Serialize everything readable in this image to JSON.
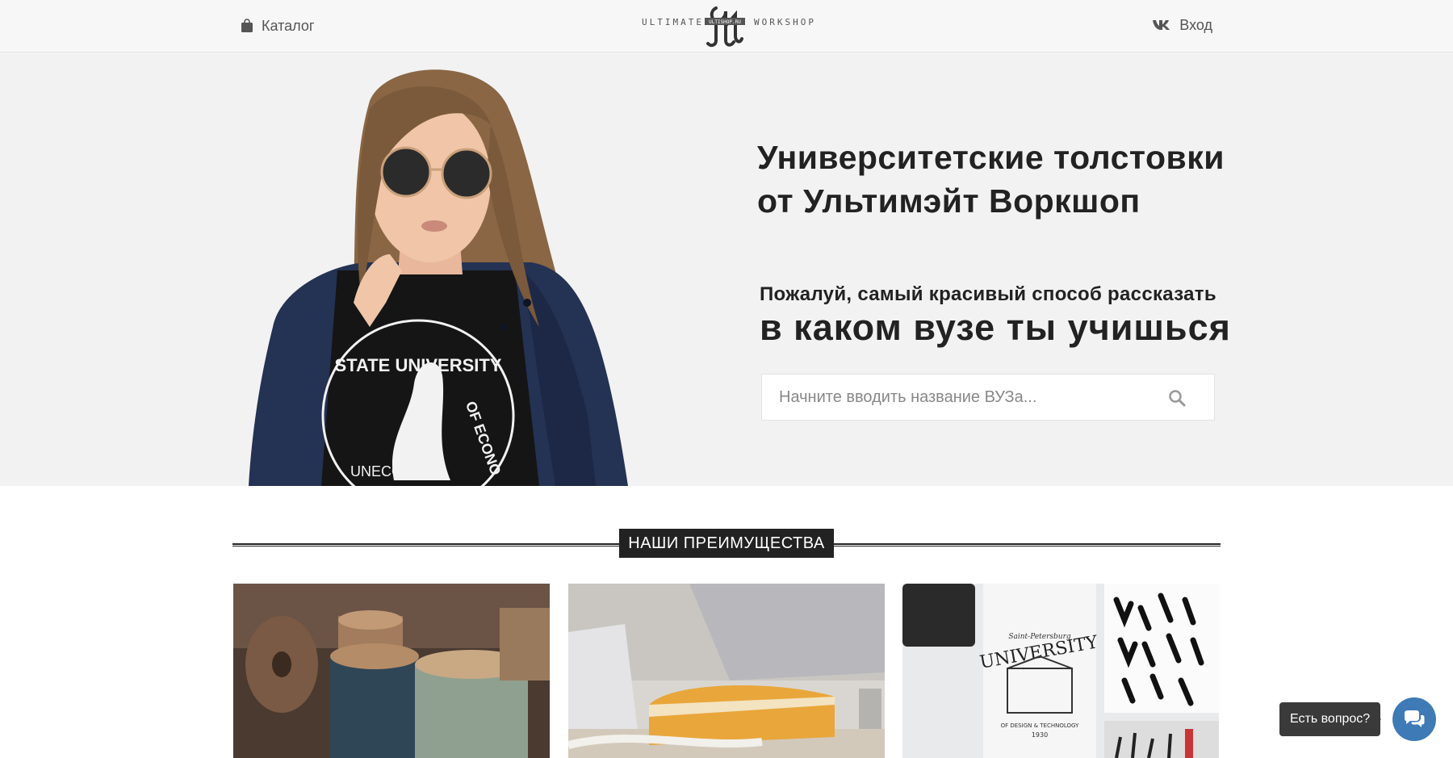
{
  "header": {
    "catalog_label": "Каталог",
    "login_label": "Вход",
    "logo": {
      "left_word": "ULTIMATE",
      "right_word": "WORKSHOP",
      "badge_text": "ULTISHOP.RU"
    }
  },
  "hero": {
    "title_line1": "Университетские толстовки",
    "title_line2": "от Ультимэйт Воркшоп",
    "subtitle_line1": "Пожалуй, самый красивый способ рассказать",
    "subtitle_line2": "в каком вузе ты учишься",
    "search": {
      "placeholder": "Начните вводить название ВУЗа...",
      "value": ""
    },
    "photo": {
      "shirt_text_top": "STATE UNIVERSITY",
      "shirt_text_right": "OF ECONO",
      "shirt_text_bottom": "UNECON"
    }
  },
  "advantages": {
    "section_title": "НАШИ ПРЕИМУЩЕСТВА",
    "cards": [
      {
        "image": "thread-spools"
      },
      {
        "image": "tailor-workbench"
      },
      {
        "image": "university-print-artwork",
        "print_small": "Saint-Petersburg",
        "print_big": "UNIVERSITY",
        "print_bottom": "OF DESIGN & TECHNOLOGY",
        "print_year": "1930"
      }
    ]
  },
  "chat": {
    "label": "Есть вопрос?"
  },
  "colors": {
    "header_bg": "#f7f7f7",
    "hero_bg": "#f2f2f2",
    "section_bar": "#222222",
    "chat_button": "#3d7ab6"
  },
  "icons": [
    "shopping-bag-icon",
    "vk-icon",
    "search-icon",
    "chat-bubbles-icon"
  ]
}
